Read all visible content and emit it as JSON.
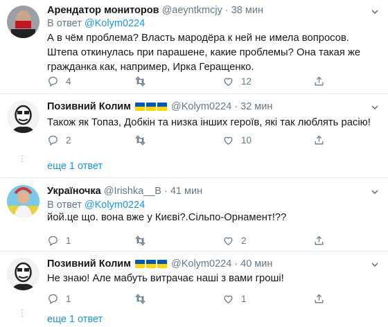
{
  "tweets": [
    {
      "name": "Арендатор мониторов",
      "handle": "@aeyntkmcjy",
      "time": "· 38 мин",
      "reply_prefix": "В ответ",
      "reply_to": "@Kolym0224",
      "text": "А в чём проблема? Власть мародёра к ней не имела вопросов. Штепа откинулась при парашене, какие проблемы? Она такая же гражданка как, например, Ирка Геращенко.",
      "replies": "4",
      "retweets": "",
      "likes": "12"
    },
    {
      "name": "Позивний Колим",
      "handle": "@Kolym0224",
      "time": "· 32 мин",
      "text": "Також як Топаз, Добкін та низка інших героїв, які так люблять расію!",
      "replies": "2",
      "retweets": "",
      "likes": "10"
    },
    {
      "name": "Україночка",
      "handle": "@Irishka__B",
      "time": "· 41 мин",
      "reply_prefix": "В ответ",
      "reply_to": "@Kolym0224",
      "text": "йой.це що. вона вже у Києві?.Сільпо-Орнамент!??",
      "replies": "1",
      "retweets": "",
      "likes": "2"
    },
    {
      "name": "Позивний Колим",
      "handle": "@Kolym0224",
      "time": "· 40 мин",
      "text": "Не знаю! Але мабуть витрачає наші з вами гроші!",
      "replies": "1",
      "retweets": "",
      "likes": "1"
    }
  ],
  "show_more": [
    "еще 1 ответ",
    "еще 1 ответ"
  ],
  "icons": {
    "reply": "reply-icon",
    "retweet": "retweet-icon",
    "like": "heart-icon",
    "share": "share-icon",
    "caret": "chevron-down-icon",
    "flag": "ukraine-flag-icon"
  },
  "colors": {
    "link": "#1b95e0",
    "muted": "#657786",
    "text": "#14171a",
    "divider": "#e6ecf0",
    "flag_blue": "#0057b7",
    "flag_yellow": "#ffd700"
  }
}
